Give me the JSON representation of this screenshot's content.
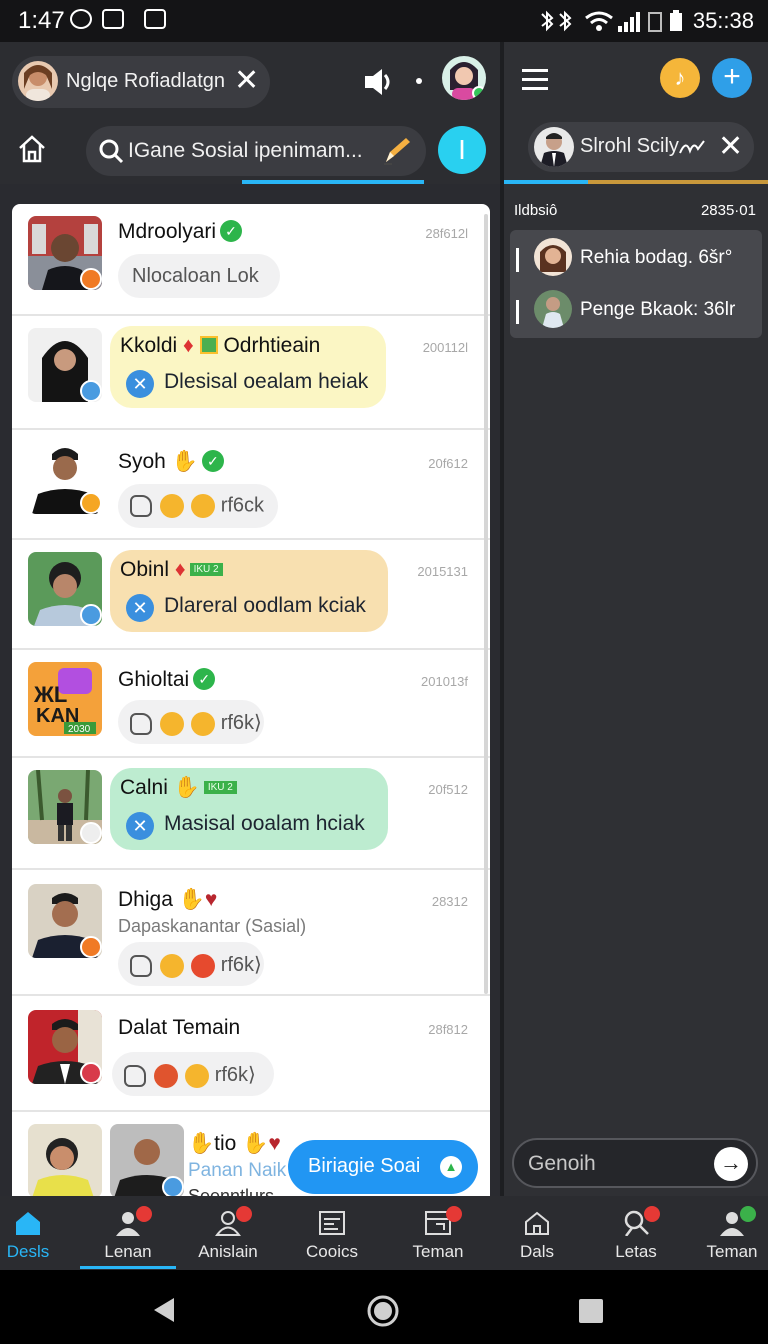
{
  "status": {
    "time": "1:47",
    "battery": "35::38"
  },
  "left_header": {
    "contact_chip": "Nglqe Rofiadlatgn",
    "search_text": "IGane Sosial ipenimam...",
    "search_button": "I"
  },
  "right_header": {
    "chip": "Slrohl Scily"
  },
  "right_panel": {
    "title": "Ildbsiô",
    "date": "2835·01",
    "items": [
      {
        "label": "Rehia bodag. 6šr°"
      },
      {
        "label": "Penge Bkaok: 36lr"
      }
    ],
    "input_placeholder": "Genoih"
  },
  "chats": [
    {
      "name": "Mdroolyari",
      "date": "28f612l",
      "preview": "Nlocaloan Lok"
    },
    {
      "name": "Kkoldi",
      "name2": "Odrhtieain",
      "date": "200112l",
      "preview": "Dlesisal oealam heiak"
    },
    {
      "name": "Syoh",
      "date": "20f612",
      "preview": "rf6ck"
    },
    {
      "name": "Obinl",
      "tag": "IKU 2",
      "date": "2015131",
      "preview": "Dlareral oodlam kciak"
    },
    {
      "name": "Ghioltai",
      "date": "201013f",
      "preview": "rf6k⟩"
    },
    {
      "name": "Calni",
      "tag": "IKU 2",
      "date": "20f512",
      "preview": "Masisal ooalam hciak"
    },
    {
      "name": "Dhiga",
      "date": "28312",
      "sub": "Dapaskanantar (Sasial)",
      "preview": "rf6k⟩"
    },
    {
      "name": "Dalat Temain",
      "date": "28f812",
      "preview": "rf6k⟩"
    },
    {
      "name": "tio",
      "sub": "Panan Naik",
      "preview": "Seenntlurs"
    }
  ],
  "logo_text": "KAN",
  "logo_year": "2030",
  "fab": {
    "label": "Biriagie Soai"
  },
  "nav": [
    {
      "label": "Desls"
    },
    {
      "label": "Lenan"
    },
    {
      "label": "Anislain"
    },
    {
      "label": "Cooics"
    },
    {
      "label": "Teman"
    },
    {
      "label": "Dals"
    },
    {
      "label": "Letas"
    },
    {
      "label": "Teman"
    }
  ],
  "colors": {
    "accent": "#29b6f6",
    "fab": "#2196f3",
    "yellow_bubble": "#fbf6c4",
    "tan_bubble": "#f8e0b0",
    "green_bubble": "#bdecd0"
  }
}
